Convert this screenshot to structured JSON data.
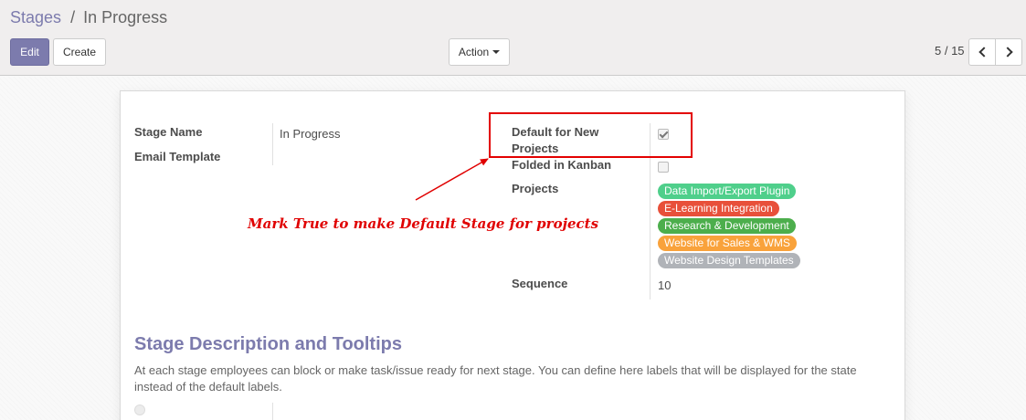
{
  "breadcrumb": {
    "parent": "Stages",
    "separator": "/",
    "current": "In Progress"
  },
  "toolbar": {
    "edit_label": "Edit",
    "create_label": "Create",
    "action_label": "Action"
  },
  "pager": {
    "value": "5 / 15"
  },
  "form": {
    "stage_name_label": "Stage Name",
    "stage_name_value": "In Progress",
    "email_template_label": "Email Template",
    "default_new_projects_label_line1": "Default for New",
    "default_new_projects_label_line2": "Projects",
    "default_new_projects_checked": true,
    "folded_label": "Folded in Kanban",
    "folded_checked": false,
    "projects_label": "Projects",
    "projects": [
      {
        "name": "Data Import/Export Plugin",
        "color": "#4fcf8b"
      },
      {
        "name": "E-Learning Integration",
        "color": "#e8503a"
      },
      {
        "name": "Research & Development",
        "color": "#4cae4c"
      },
      {
        "name": "Website for Sales & WMS",
        "color": "#f9a23b"
      },
      {
        "name": "Website Design Templates",
        "color": "#b0b3b8"
      }
    ],
    "sequence_label": "Sequence",
    "sequence_value": "10"
  },
  "annotation": {
    "text": "Mark True to make Default Stage for projects",
    "color": "#e00000"
  },
  "section": {
    "title": "Stage Description and Tooltips",
    "description": "At each stage employees can block or make task/issue ready for next stage. You can define here labels that will be displayed for the state instead of the default labels."
  },
  "colors": {
    "accent": "#7c7bad",
    "annotation": "#e00000"
  }
}
